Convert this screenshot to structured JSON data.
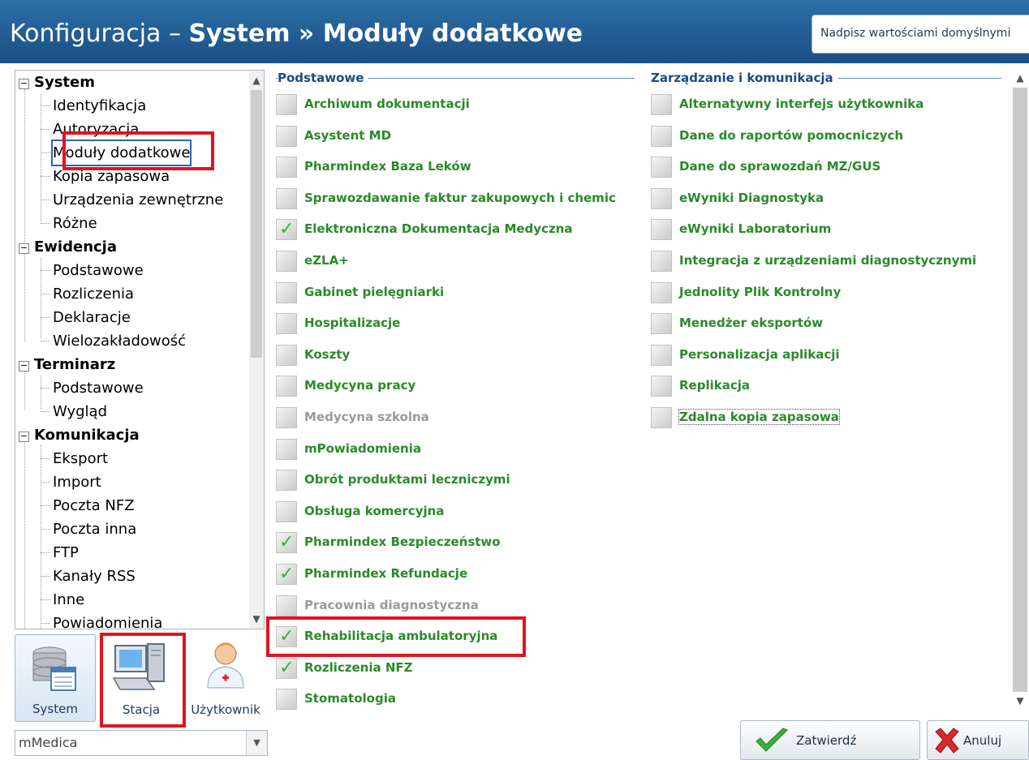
{
  "window": {
    "title_prefix": "Konfiguracja – ",
    "title_bold": "System » Moduły dodatkowe",
    "restore_defaults": "Nadpisz wartościami domyślnymi"
  },
  "tree": {
    "system": {
      "label": "System",
      "children": [
        "Identyfikacja",
        "Autoryzacja",
        "Moduły dodatkowe",
        "Kopia zapasowa",
        "Urządzenia zewnętrzne",
        "Różne"
      ]
    },
    "ewidencja": {
      "label": "Ewidencja",
      "children": [
        "Podstawowe",
        "Rozliczenia",
        "Deklaracje",
        "Wielozakładowość"
      ]
    },
    "terminarz": {
      "label": "Terminarz",
      "children": [
        "Podstawowe",
        "Wygląd"
      ]
    },
    "komunikacja": {
      "label": "Komunikacja",
      "children": [
        "Eksport",
        "Import",
        "Poczta NFZ",
        "Poczta inna",
        "FTP",
        "Kanały RSS",
        "Inne",
        "Powiadomienia"
      ]
    },
    "selected": "Moduły dodatkowe"
  },
  "tiles": {
    "system": "System",
    "stacja": "Stacja",
    "user": "Użytkownik"
  },
  "dropdown": {
    "value": "mMedica"
  },
  "groups": {
    "basic": {
      "title": "Podstawowe",
      "modules": [
        {
          "label": "Archiwum dokumentacji",
          "checked": false
        },
        {
          "label": "Asystent MD",
          "checked": false
        },
        {
          "label": "Pharmindex Baza Leków",
          "checked": false
        },
        {
          "label": "Sprawozdawanie faktur zakupowych i chemic",
          "checked": false
        },
        {
          "label": "Elektroniczna Dokumentacja Medyczna",
          "checked": true
        },
        {
          "label": "eZLA+",
          "checked": false
        },
        {
          "label": "Gabinet pielęgniarki",
          "checked": false
        },
        {
          "label": "Hospitalizacje",
          "checked": false
        },
        {
          "label": "Koszty",
          "checked": false
        },
        {
          "label": "Medycyna pracy",
          "checked": false
        },
        {
          "label": "Medycyna szkolna",
          "checked": false,
          "disabled": true
        },
        {
          "label": "mPowiadomienia",
          "checked": false
        },
        {
          "label": "Obrót produktami leczniczymi",
          "checked": false
        },
        {
          "label": "Obsługa komercyjna",
          "checked": false
        },
        {
          "label": "Pharmindex Bezpieczeństwo",
          "checked": true
        },
        {
          "label": "Pharmindex Refundacje",
          "checked": true
        },
        {
          "label": "Pracownia diagnostyczna",
          "checked": false,
          "disabled": true
        },
        {
          "label": "Rehabilitacja ambulatoryjna",
          "checked": true
        },
        {
          "label": "Rozliczenia NFZ",
          "checked": true
        },
        {
          "label": "Stomatologia",
          "checked": false
        }
      ]
    },
    "management": {
      "title": "Zarządzanie i komunikacja",
      "modules": [
        {
          "label": "Alternatywny interfejs użytkownika",
          "checked": false
        },
        {
          "label": "Dane do raportów pomocniczych",
          "checked": false
        },
        {
          "label": "Dane do sprawozdań MZ/GUS",
          "checked": false
        },
        {
          "label": "eWyniki Diagnostyka",
          "checked": false
        },
        {
          "label": "eWyniki Laboratorium",
          "checked": false
        },
        {
          "label": "Integracja z urządzeniami diagnostycznymi",
          "checked": false
        },
        {
          "label": "Jednolity Plik Kontrolny",
          "checked": false
        },
        {
          "label": "Menedżer eksportów",
          "checked": false
        },
        {
          "label": "Personalizacja aplikacji",
          "checked": false
        },
        {
          "label": "Replikacja",
          "checked": false
        },
        {
          "label": "Zdalna kopia zapasowa",
          "checked": false
        }
      ]
    }
  },
  "buttons": {
    "ok": "Zatwierdź",
    "cancel": "Anuluj"
  },
  "colors": {
    "header": "#1a4f83",
    "module_text": "#2a8a2a",
    "highlight": "#e1141e",
    "check": "#3fae3f"
  }
}
